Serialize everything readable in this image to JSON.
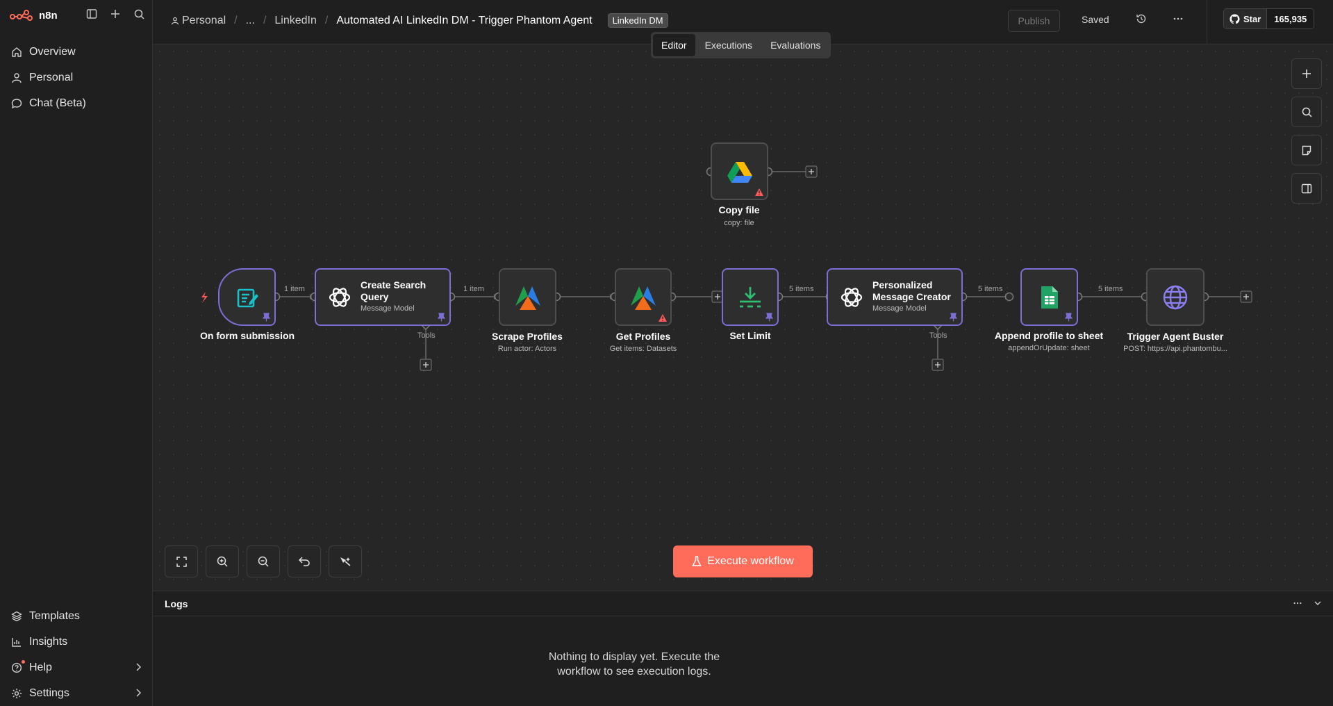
{
  "app": {
    "brand": "n8n"
  },
  "sidebar": {
    "items": [
      {
        "label": "Overview",
        "icon": "home-icon"
      },
      {
        "label": "Personal",
        "icon": "user-icon"
      },
      {
        "label": "Chat (Beta)",
        "icon": "chat-icon"
      }
    ],
    "bottom_items": [
      {
        "label": "Templates",
        "icon": "templates-icon"
      },
      {
        "label": "Insights",
        "icon": "insights-icon"
      },
      {
        "label": "Help",
        "icon": "help-icon"
      },
      {
        "label": "Settings",
        "icon": "settings-icon"
      }
    ]
  },
  "header": {
    "breadcrumb": [
      "Personal",
      "...",
      "LinkedIn"
    ],
    "workflow_title": "Automated AI LinkedIn DM - Trigger Phantom Agent",
    "tag": "LinkedIn DM",
    "publish_label": "Publish",
    "status": "Saved",
    "github_star": "Star",
    "github_count": "165,935"
  },
  "tabs": [
    {
      "label": "Editor",
      "active": true
    },
    {
      "label": "Executions",
      "active": false
    },
    {
      "label": "Evaluations",
      "active": false
    }
  ],
  "nodes": [
    {
      "name": "Copy file",
      "subtitle": "copy: file",
      "icon": "google-drive-icon",
      "warning": true
    },
    {
      "name": "On form submission",
      "subtitle": "",
      "icon": "form-icon",
      "pinned": true,
      "trigger": true
    },
    {
      "name": "Create Search Query",
      "subtitle": "Message Model",
      "icon": "openai-icon",
      "pinned": true
    },
    {
      "name": "Scrape Profiles",
      "subtitle": "Run actor: Actors",
      "icon": "apify-icon"
    },
    {
      "name": "Get Profiles",
      "subtitle": "Get items: Datasets",
      "icon": "apify-icon",
      "warning": true
    },
    {
      "name": "Set Limit",
      "subtitle": "",
      "icon": "limit-icon",
      "pinned": true
    },
    {
      "name": "Personalized Message Creator",
      "subtitle": "Message Model",
      "icon": "openai-icon",
      "pinned": true
    },
    {
      "name": "Append profile to sheet",
      "subtitle": "appendOrUpdate: sheet",
      "icon": "google-sheets-icon",
      "pinned": true
    },
    {
      "name": "Trigger Agent Buster",
      "subtitle": "POST: https://api.phantombu...",
      "icon": "globe-icon"
    }
  ],
  "connections": [
    "1 item",
    "1 item",
    "5 items",
    "5 items",
    "5 items"
  ],
  "tools_label": "Tools",
  "canvas": {
    "execute_label": "Execute workflow"
  },
  "logs": {
    "title": "Logs",
    "empty_line1": "Nothing to display yet. Execute the",
    "empty_line2": "workflow to see execution logs."
  },
  "colors": {
    "accent": "#ff6d5a",
    "pinned": "#7b6fd6",
    "canvas": "#262626"
  }
}
